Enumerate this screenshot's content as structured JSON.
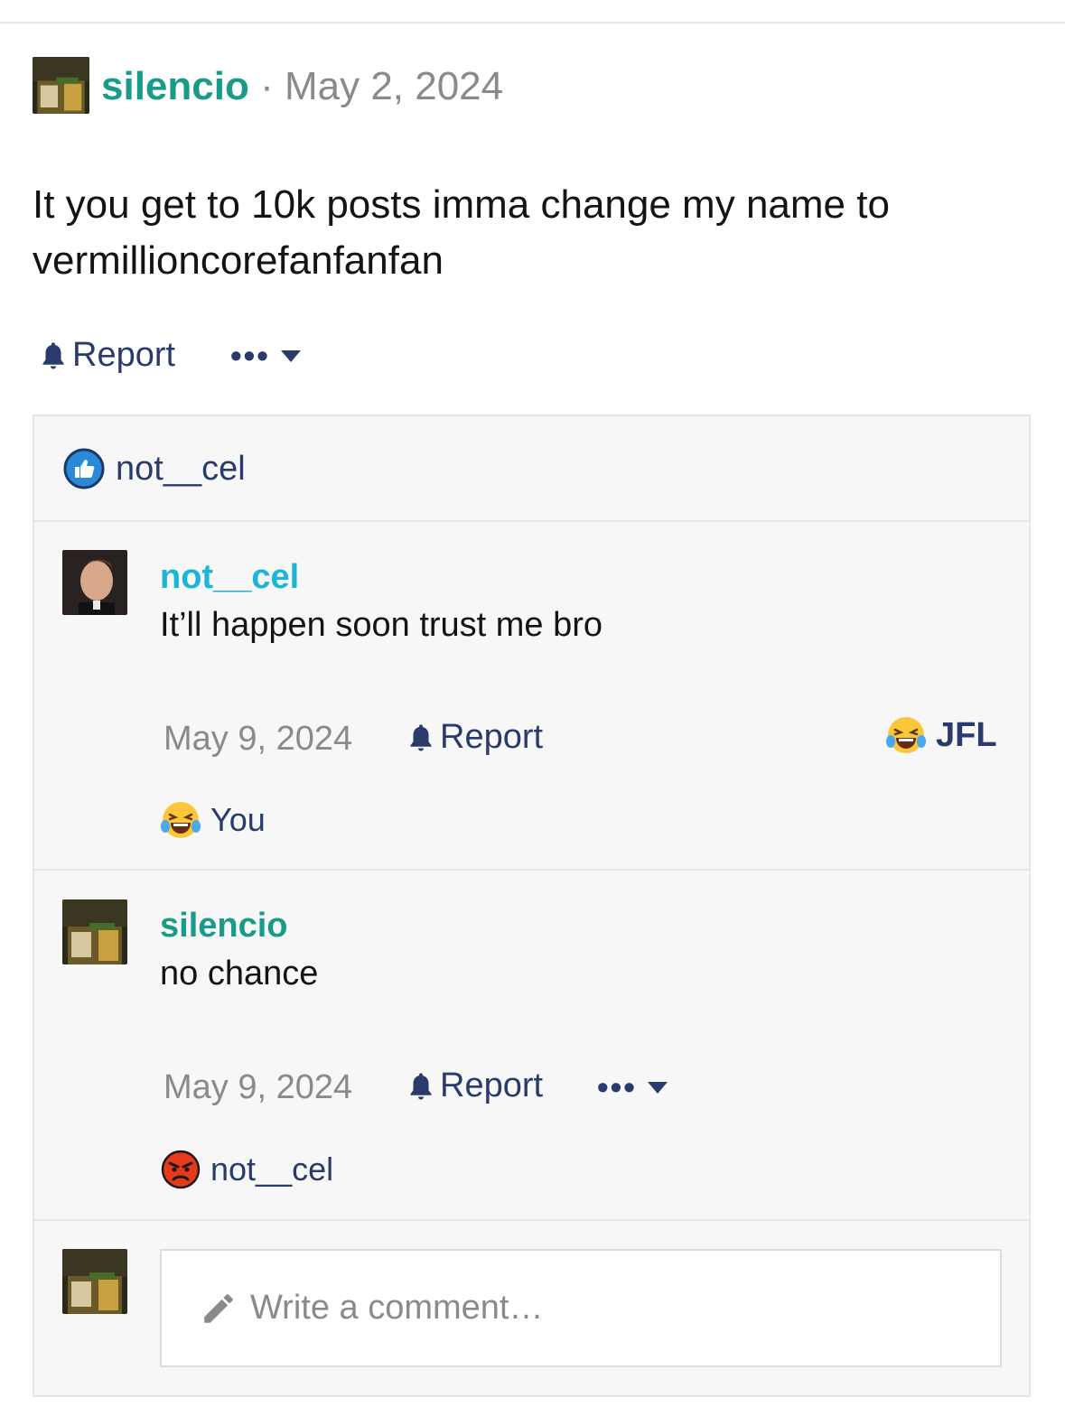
{
  "post": {
    "username": "silencio",
    "separator": "·",
    "date": "May 2, 2024",
    "body": "It you get to 10k posts imma change my name to vermillioncorefanfanfan",
    "report_label": "Report",
    "more_label": "•••"
  },
  "likes": {
    "icon": "thumbs-up-icon",
    "user": "not__cel"
  },
  "comments": [
    {
      "username": "not__cel",
      "username_color": "#1ab6d6",
      "text": "It’ll happen soon trust me bro",
      "date": "May 9, 2024",
      "report_label": "Report",
      "reaction_button": {
        "icon": "laughing-crying-emoji-icon",
        "label": "JFL"
      },
      "reaction": {
        "icon": "laughing-crying-emoji-icon",
        "by": "You"
      }
    },
    {
      "username": "silencio",
      "username_color": "#1a9b8a",
      "text": "no chance",
      "date": "May 9, 2024",
      "report_label": "Report",
      "more_label": "•••",
      "reaction": {
        "icon": "angry-face-emoji-icon",
        "by": "not__cel"
      }
    }
  ],
  "composer": {
    "placeholder": "Write a comment…",
    "icon": "pencil-icon"
  },
  "colors": {
    "link": "#2a3a6b",
    "muted": "#8a8a8a",
    "accent": "#1a9b8a"
  }
}
